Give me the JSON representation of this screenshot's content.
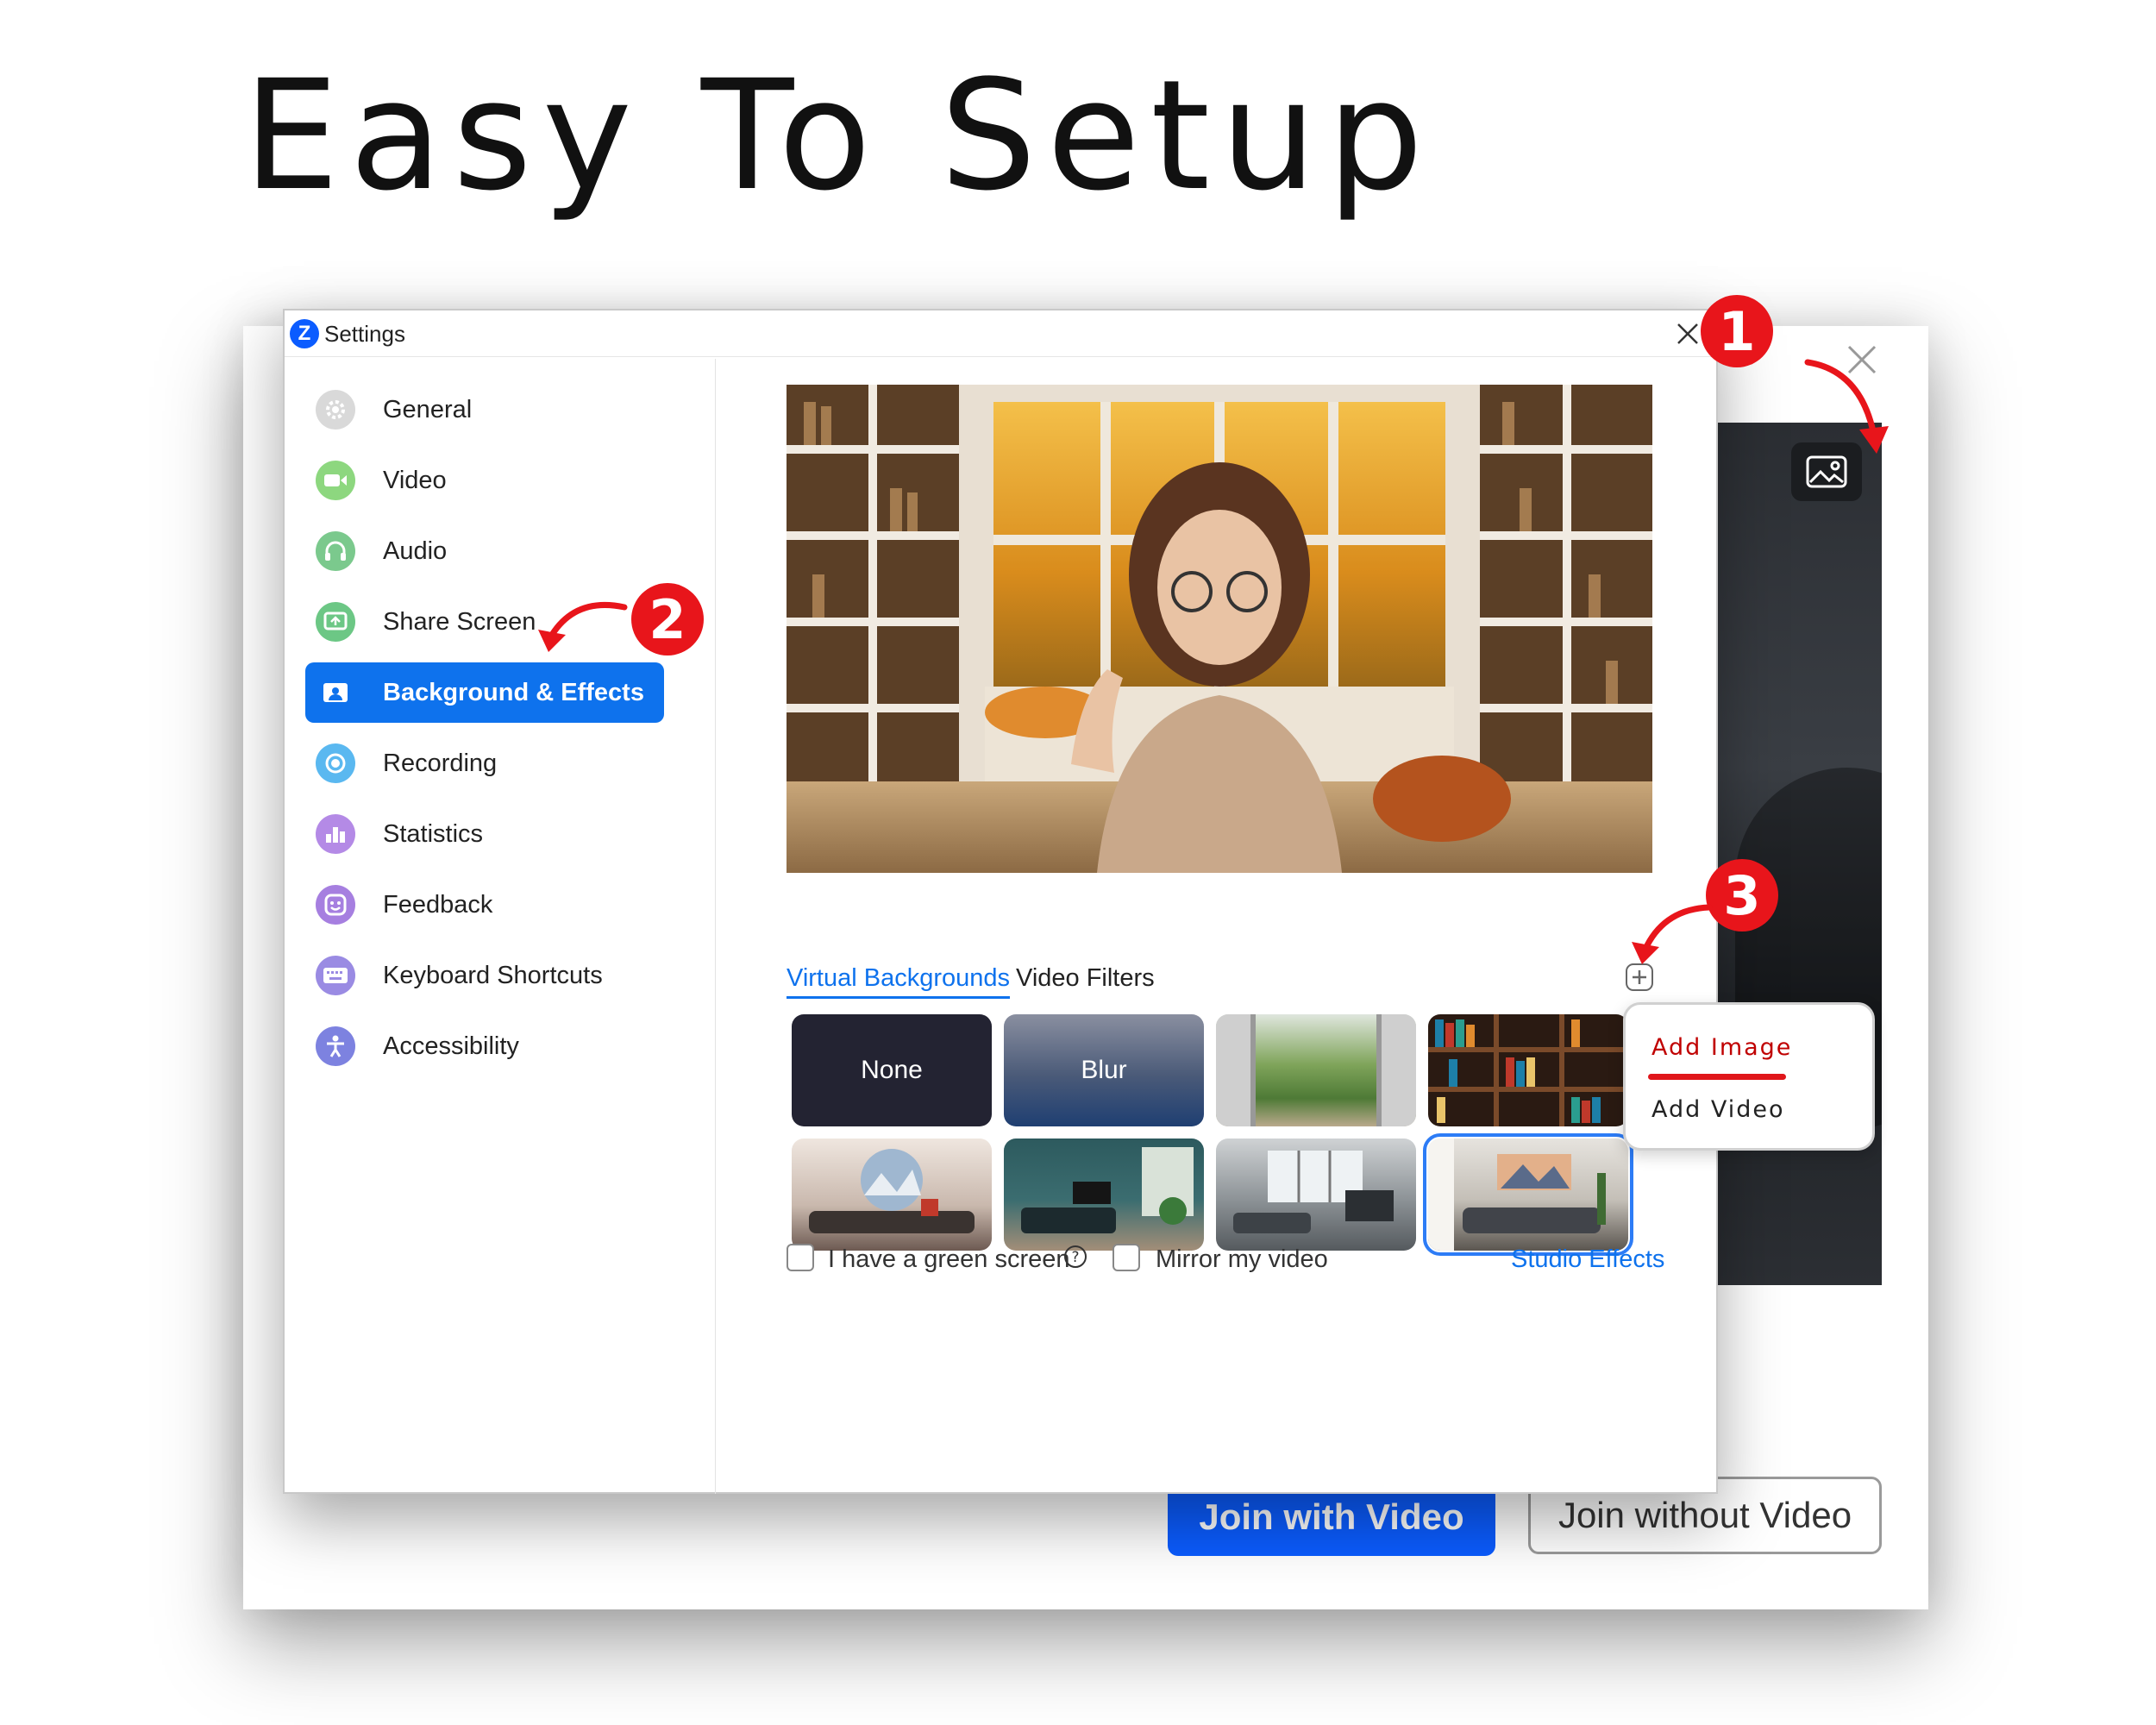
{
  "headline": "Easy To Setup",
  "dialog": {
    "title": "Settings",
    "app_logo_letter": "Z"
  },
  "sidebar": {
    "items": [
      {
        "label": "General",
        "icon": "gear-icon",
        "color": "#d9d9d9"
      },
      {
        "label": "Video",
        "icon": "camera-icon",
        "color": "#8dd77f"
      },
      {
        "label": "Audio",
        "icon": "headphones-icon",
        "color": "#7bc98d"
      },
      {
        "label": "Share Screen",
        "icon": "share-screen-icon",
        "color": "#6cc785"
      },
      {
        "label": "Background & Effects",
        "icon": "portrait-icon",
        "color": "#ffffff",
        "active": true
      },
      {
        "label": "Recording",
        "icon": "record-icon",
        "color": "#5ab8f0"
      },
      {
        "label": "Statistics",
        "icon": "bar-chart-icon",
        "color": "#b48ae6"
      },
      {
        "label": "Feedback",
        "icon": "smiley-icon",
        "color": "#a67fe0"
      },
      {
        "label": "Keyboard Shortcuts",
        "icon": "keyboard-icon",
        "color": "#9a8be3"
      },
      {
        "label": "Accessibility",
        "icon": "accessibility-icon",
        "color": "#7d82e0"
      }
    ]
  },
  "tabs": {
    "virtual_backgrounds": "Virtual Backgrounds",
    "video_filters": "Video Filters"
  },
  "thumbnails": [
    {
      "label": "None",
      "kind": "solid"
    },
    {
      "label": "Blur",
      "kind": "blur"
    },
    {
      "label": "",
      "kind": "garden"
    },
    {
      "label": "",
      "kind": "bookshelf"
    },
    {
      "label": "",
      "kind": "round-window-room"
    },
    {
      "label": "",
      "kind": "teal-living-room"
    },
    {
      "label": "",
      "kind": "grey-living-room"
    },
    {
      "label": "",
      "kind": "mountain-art-room",
      "selected": true
    }
  ],
  "options": {
    "green_screen": "I have a green screen",
    "mirror": "Mirror my video",
    "studio_effects": "Studio Effects"
  },
  "popup": {
    "add_image": "Add Image",
    "add_video": "Add Video"
  },
  "back_window": {
    "join_with_video": "Join with Video",
    "join_without_video": "Join without Video"
  },
  "steps": [
    "1",
    "2",
    "3"
  ],
  "colors": {
    "accent": "#0e72ed",
    "step_red": "#e8151b",
    "join_blue": "#0b5cff"
  }
}
